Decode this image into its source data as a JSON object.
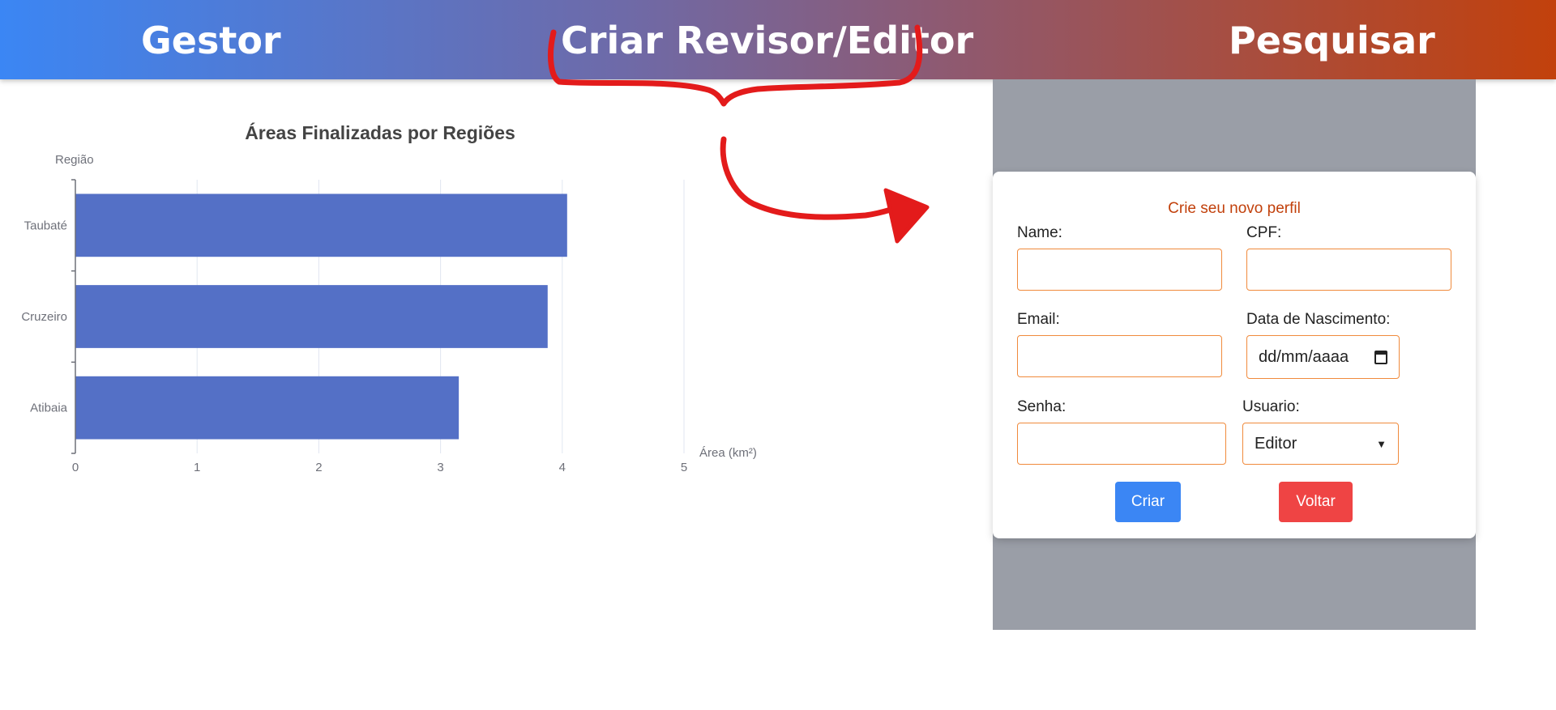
{
  "nav": {
    "gestor": "Gestor",
    "criar": "Criar Revisor/Editor",
    "pesquisar": "Pesquisar"
  },
  "chart_data": {
    "type": "bar",
    "orientation": "horizontal",
    "title": "Áreas Finalizadas por Regiões",
    "ylabel": "Região",
    "xlabel": "Área (km²)",
    "categories": [
      "Taubaté",
      "Cruzeiro",
      "Atibaia"
    ],
    "values": [
      4.04,
      3.88,
      3.15
    ],
    "xlim": [
      0,
      5
    ],
    "xticks": [
      "0",
      "1",
      "2",
      "3",
      "4",
      "5"
    ],
    "bar_color": "#5470c6",
    "grid": true
  },
  "form": {
    "title": "Crie seu novo perfil",
    "name_label": "Name:",
    "name_value": "",
    "cpf_label": "CPF:",
    "cpf_value": "",
    "email_label": "Email:",
    "email_value": "",
    "birth_label": "Data de Nascimento:",
    "birth_placeholder": "dd/mm/aaaa",
    "password_label": "Senha:",
    "password_value": "",
    "user_label": "Usuario:",
    "user_selected": "Editor",
    "create_label": "Criar",
    "back_label": "Voltar"
  },
  "colors": {
    "accent_form": "#c2410c",
    "input_border": "#f08a3c",
    "create": "#3b86f4",
    "back": "#ef4444",
    "annotation": "#e31b1b"
  }
}
